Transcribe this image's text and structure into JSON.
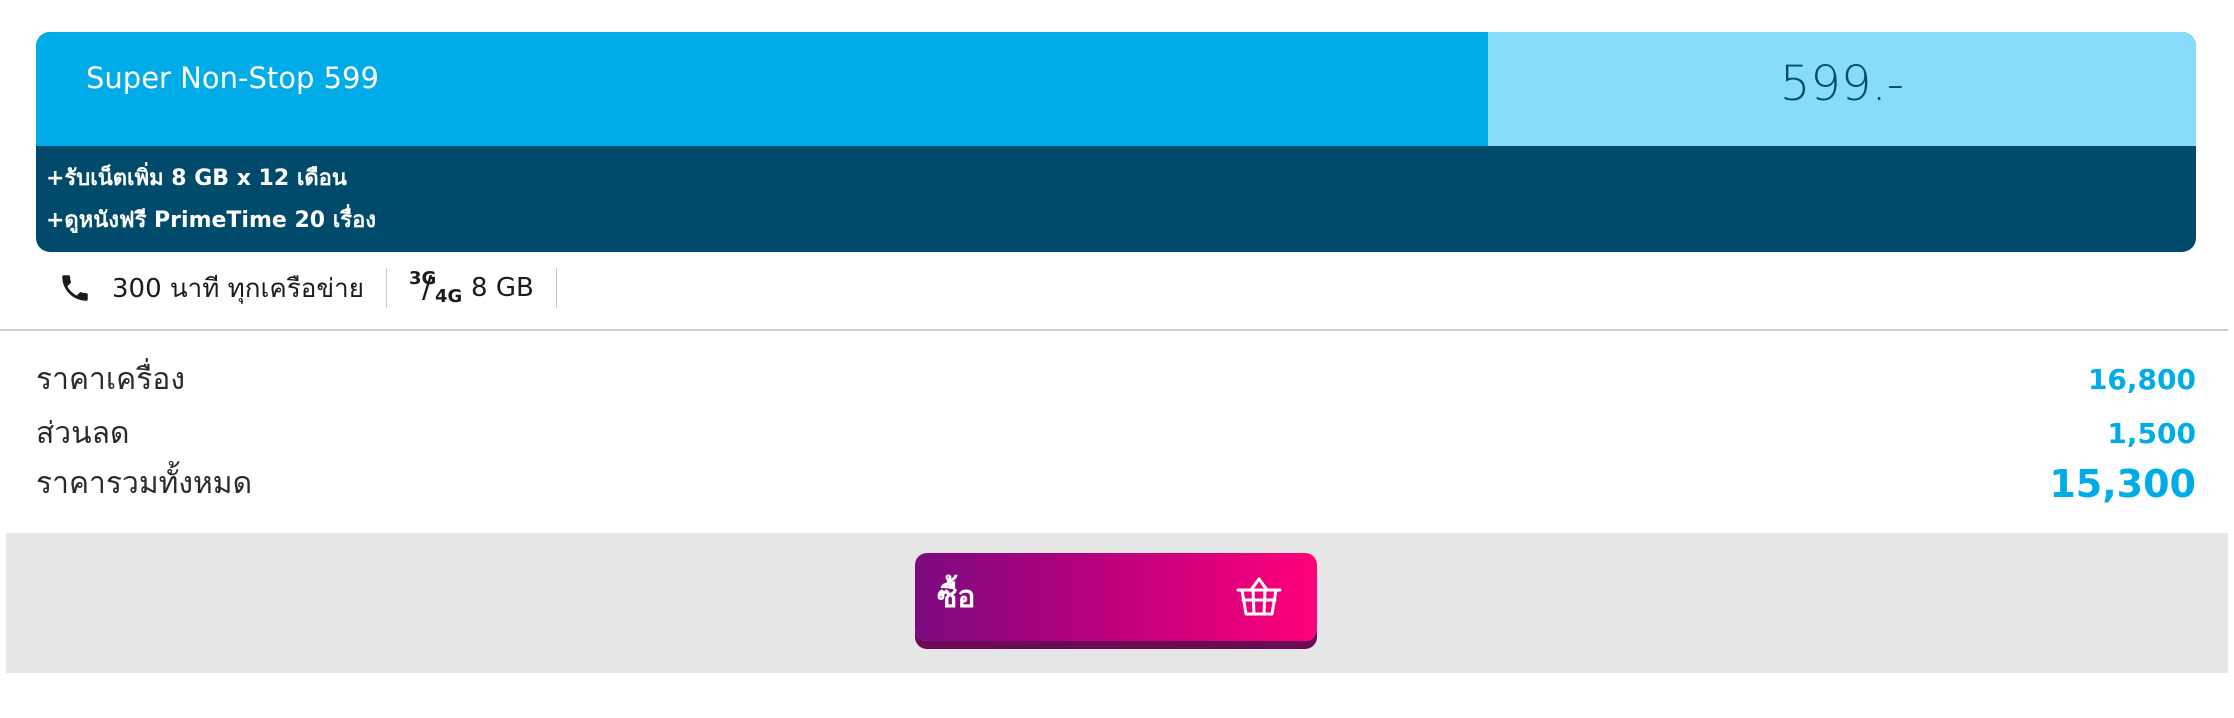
{
  "package": {
    "name": "Super Non-Stop 599",
    "price": "599.-",
    "benefits": [
      "+รับเน็ตเพิ่ม 8 GB x 12 เดือน",
      "+ดูหนังฟรี PrimeTime 20 เรื่อง"
    ]
  },
  "features": {
    "calls": {
      "icon": "phone-icon",
      "text": "300 นาที ทุกเครือข่าย"
    },
    "data": {
      "icon_top": "3G",
      "icon_bottom": "4G",
      "text": "8 GB"
    }
  },
  "pricing": {
    "device_price_label": "ราคาเครื่อง",
    "device_price_value": "16,800",
    "discount_label": "ส่วนลด",
    "discount_value": "1,500",
    "total_label": "ราคารวมทั้งหมด",
    "total_value": "15,300"
  },
  "buy": {
    "label": "ซื้อ",
    "icon": "basket-icon"
  },
  "colors": {
    "accent": "#00ace8",
    "accent_light": "#87dcfb",
    "dark_blue": "#004a6b",
    "buy_gradient_start": "#7b0a80",
    "buy_gradient_end": "#ff007a"
  }
}
